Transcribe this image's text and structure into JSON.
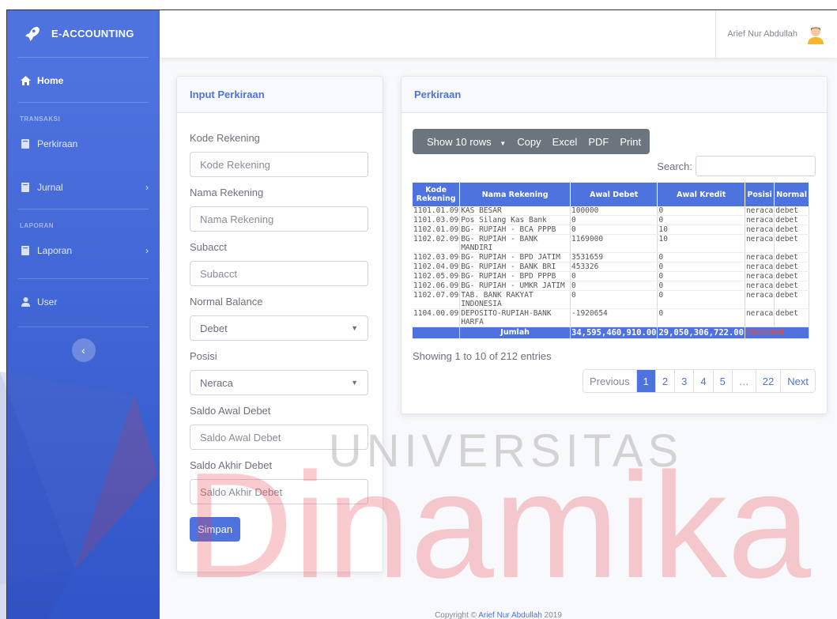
{
  "brand": {
    "name": "E-ACCOUNTING"
  },
  "sidebar": {
    "home": "Home",
    "heading_transaksi": "TRANSAKSI",
    "perkiraan": "Perkiraan",
    "jurnal": "Jurnal",
    "heading_laporan": "LAPORAN",
    "laporan": "Laporan",
    "user": "User"
  },
  "topbar": {
    "user_name": "Arief Nur Abdullah"
  },
  "form": {
    "title": "Input Perkiraan",
    "kode_label": "Kode Rekening",
    "kode_placeholder": "Kode Rekening",
    "nama_label": "Nama Rekening",
    "nama_placeholder": "Nama Rekening",
    "subacct_label": "Subacct",
    "subacct_placeholder": "Subacct",
    "normal_label": "Normal Balance",
    "normal_value": "Debet",
    "posisi_label": "Posisi",
    "posisi_value": "Neraca",
    "saldo_awal_label": "Saldo Awal Debet",
    "saldo_awal_placeholder": "Saldo Awal Debet",
    "saldo_akhir_label": "Saldo Akhir Debet",
    "saldo_akhir_placeholder": "Saldo Akhir Debet",
    "submit": "Simpan"
  },
  "table_card": {
    "title": "Perkiraan",
    "buttons": {
      "show": "Show 10 rows",
      "copy": "Copy",
      "excel": "Excel",
      "pdf": "PDF",
      "print": "Print"
    },
    "search_label": "Search:",
    "headers": [
      "Kode Rekening",
      "Nama Rekening",
      "Awal Debet",
      "Awal Kredit",
      "Posisi",
      "Normal"
    ],
    "rows": [
      [
        "1101.01.09",
        "KAS BESAR",
        "100000",
        "0",
        "neraca",
        "debet"
      ],
      [
        "1101.03.09",
        "Pos Silang Kas Bank",
        "0",
        "0",
        "neraca",
        "debet"
      ],
      [
        "1102.01.09",
        "BG- RUPIAH - BCA PPPB",
        "0",
        "10",
        "neraca",
        "debet"
      ],
      [
        "1102.02.09",
        "BG- RUPIAH - BANK MANDIRI",
        "1169000",
        "10",
        "neraca",
        "debet"
      ],
      [
        "1102.03.09",
        "BG- RUPIAH - BPD JATIM",
        "3531659",
        "0",
        "neraca",
        "debet"
      ],
      [
        "1102.04.09",
        "BG- RUPIAH - BANK BRI",
        "453326",
        "0",
        "neraca",
        "debet"
      ],
      [
        "1102.05.09",
        "BG- RUPIAH - BPD PPPB",
        "0",
        "0",
        "neraca",
        "debet"
      ],
      [
        "1102.06.09",
        "BG- RUPIAH - UMKR JATIM",
        "0",
        "0",
        "neraca",
        "debet"
      ],
      [
        "1102.07.09",
        "TAB. BANK RAKYAT INDONESIA",
        "0",
        "0",
        "neraca",
        "debet"
      ],
      [
        "1104.00.09",
        "DEPOSITO-RUPIAH-BANK HARFA",
        "-1920654",
        "0",
        "neraca",
        "debet"
      ]
    ],
    "total": {
      "label": "Jumlah",
      "debet": "34,595,460,910.00",
      "kredit": "29,050,306,722.00",
      "diff": "5545154188"
    },
    "info": "Showing 1 to 10 of 212 entries",
    "pagination": {
      "prev": "Previous",
      "p1": "1",
      "p2": "2",
      "p3": "3",
      "p4": "4",
      "p5": "5",
      "dots": "…",
      "last": "22",
      "next": "Next"
    }
  },
  "footer": {
    "prefix": "Copyright ©",
    "author": "Arief Nur Abdullah",
    "year": "2019"
  },
  "watermark": {
    "line1": "UNIVERSITAS",
    "line2": "Dinamika"
  },
  "colors": {
    "primary": "#4e73df",
    "danger": "#e74a3b",
    "secondary": "#6c757d",
    "watermark_red": "#e8353f"
  }
}
